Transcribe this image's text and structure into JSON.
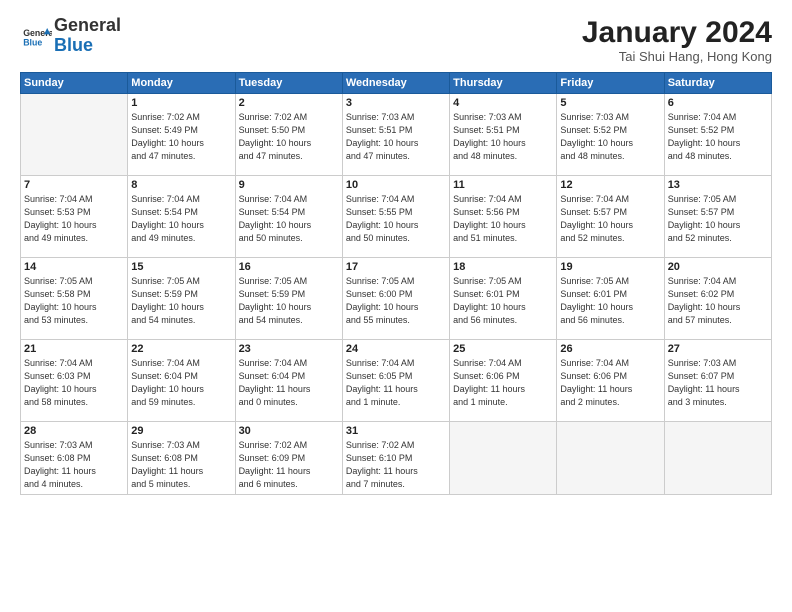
{
  "header": {
    "logo_line1": "General",
    "logo_line2": "Blue",
    "month_year": "January 2024",
    "location": "Tai Shui Hang, Hong Kong"
  },
  "weekdays": [
    "Sunday",
    "Monday",
    "Tuesday",
    "Wednesday",
    "Thursday",
    "Friday",
    "Saturday"
  ],
  "weeks": [
    [
      {
        "day": "",
        "info": ""
      },
      {
        "day": "1",
        "info": "Sunrise: 7:02 AM\nSunset: 5:49 PM\nDaylight: 10 hours\nand 47 minutes."
      },
      {
        "day": "2",
        "info": "Sunrise: 7:02 AM\nSunset: 5:50 PM\nDaylight: 10 hours\nand 47 minutes."
      },
      {
        "day": "3",
        "info": "Sunrise: 7:03 AM\nSunset: 5:51 PM\nDaylight: 10 hours\nand 47 minutes."
      },
      {
        "day": "4",
        "info": "Sunrise: 7:03 AM\nSunset: 5:51 PM\nDaylight: 10 hours\nand 48 minutes."
      },
      {
        "day": "5",
        "info": "Sunrise: 7:03 AM\nSunset: 5:52 PM\nDaylight: 10 hours\nand 48 minutes."
      },
      {
        "day": "6",
        "info": "Sunrise: 7:04 AM\nSunset: 5:52 PM\nDaylight: 10 hours\nand 48 minutes."
      }
    ],
    [
      {
        "day": "7",
        "info": "Sunrise: 7:04 AM\nSunset: 5:53 PM\nDaylight: 10 hours\nand 49 minutes."
      },
      {
        "day": "8",
        "info": "Sunrise: 7:04 AM\nSunset: 5:54 PM\nDaylight: 10 hours\nand 49 minutes."
      },
      {
        "day": "9",
        "info": "Sunrise: 7:04 AM\nSunset: 5:54 PM\nDaylight: 10 hours\nand 50 minutes."
      },
      {
        "day": "10",
        "info": "Sunrise: 7:04 AM\nSunset: 5:55 PM\nDaylight: 10 hours\nand 50 minutes."
      },
      {
        "day": "11",
        "info": "Sunrise: 7:04 AM\nSunset: 5:56 PM\nDaylight: 10 hours\nand 51 minutes."
      },
      {
        "day": "12",
        "info": "Sunrise: 7:04 AM\nSunset: 5:57 PM\nDaylight: 10 hours\nand 52 minutes."
      },
      {
        "day": "13",
        "info": "Sunrise: 7:05 AM\nSunset: 5:57 PM\nDaylight: 10 hours\nand 52 minutes."
      }
    ],
    [
      {
        "day": "14",
        "info": "Sunrise: 7:05 AM\nSunset: 5:58 PM\nDaylight: 10 hours\nand 53 minutes."
      },
      {
        "day": "15",
        "info": "Sunrise: 7:05 AM\nSunset: 5:59 PM\nDaylight: 10 hours\nand 54 minutes."
      },
      {
        "day": "16",
        "info": "Sunrise: 7:05 AM\nSunset: 5:59 PM\nDaylight: 10 hours\nand 54 minutes."
      },
      {
        "day": "17",
        "info": "Sunrise: 7:05 AM\nSunset: 6:00 PM\nDaylight: 10 hours\nand 55 minutes."
      },
      {
        "day": "18",
        "info": "Sunrise: 7:05 AM\nSunset: 6:01 PM\nDaylight: 10 hours\nand 56 minutes."
      },
      {
        "day": "19",
        "info": "Sunrise: 7:05 AM\nSunset: 6:01 PM\nDaylight: 10 hours\nand 56 minutes."
      },
      {
        "day": "20",
        "info": "Sunrise: 7:04 AM\nSunset: 6:02 PM\nDaylight: 10 hours\nand 57 minutes."
      }
    ],
    [
      {
        "day": "21",
        "info": "Sunrise: 7:04 AM\nSunset: 6:03 PM\nDaylight: 10 hours\nand 58 minutes."
      },
      {
        "day": "22",
        "info": "Sunrise: 7:04 AM\nSunset: 6:04 PM\nDaylight: 10 hours\nand 59 minutes."
      },
      {
        "day": "23",
        "info": "Sunrise: 7:04 AM\nSunset: 6:04 PM\nDaylight: 11 hours\nand 0 minutes."
      },
      {
        "day": "24",
        "info": "Sunrise: 7:04 AM\nSunset: 6:05 PM\nDaylight: 11 hours\nand 1 minute."
      },
      {
        "day": "25",
        "info": "Sunrise: 7:04 AM\nSunset: 6:06 PM\nDaylight: 11 hours\nand 1 minute."
      },
      {
        "day": "26",
        "info": "Sunrise: 7:04 AM\nSunset: 6:06 PM\nDaylight: 11 hours\nand 2 minutes."
      },
      {
        "day": "27",
        "info": "Sunrise: 7:03 AM\nSunset: 6:07 PM\nDaylight: 11 hours\nand 3 minutes."
      }
    ],
    [
      {
        "day": "28",
        "info": "Sunrise: 7:03 AM\nSunset: 6:08 PM\nDaylight: 11 hours\nand 4 minutes."
      },
      {
        "day": "29",
        "info": "Sunrise: 7:03 AM\nSunset: 6:08 PM\nDaylight: 11 hours\nand 5 minutes."
      },
      {
        "day": "30",
        "info": "Sunrise: 7:02 AM\nSunset: 6:09 PM\nDaylight: 11 hours\nand 6 minutes."
      },
      {
        "day": "31",
        "info": "Sunrise: 7:02 AM\nSunset: 6:10 PM\nDaylight: 11 hours\nand 7 minutes."
      },
      {
        "day": "",
        "info": ""
      },
      {
        "day": "",
        "info": ""
      },
      {
        "day": "",
        "info": ""
      }
    ]
  ]
}
